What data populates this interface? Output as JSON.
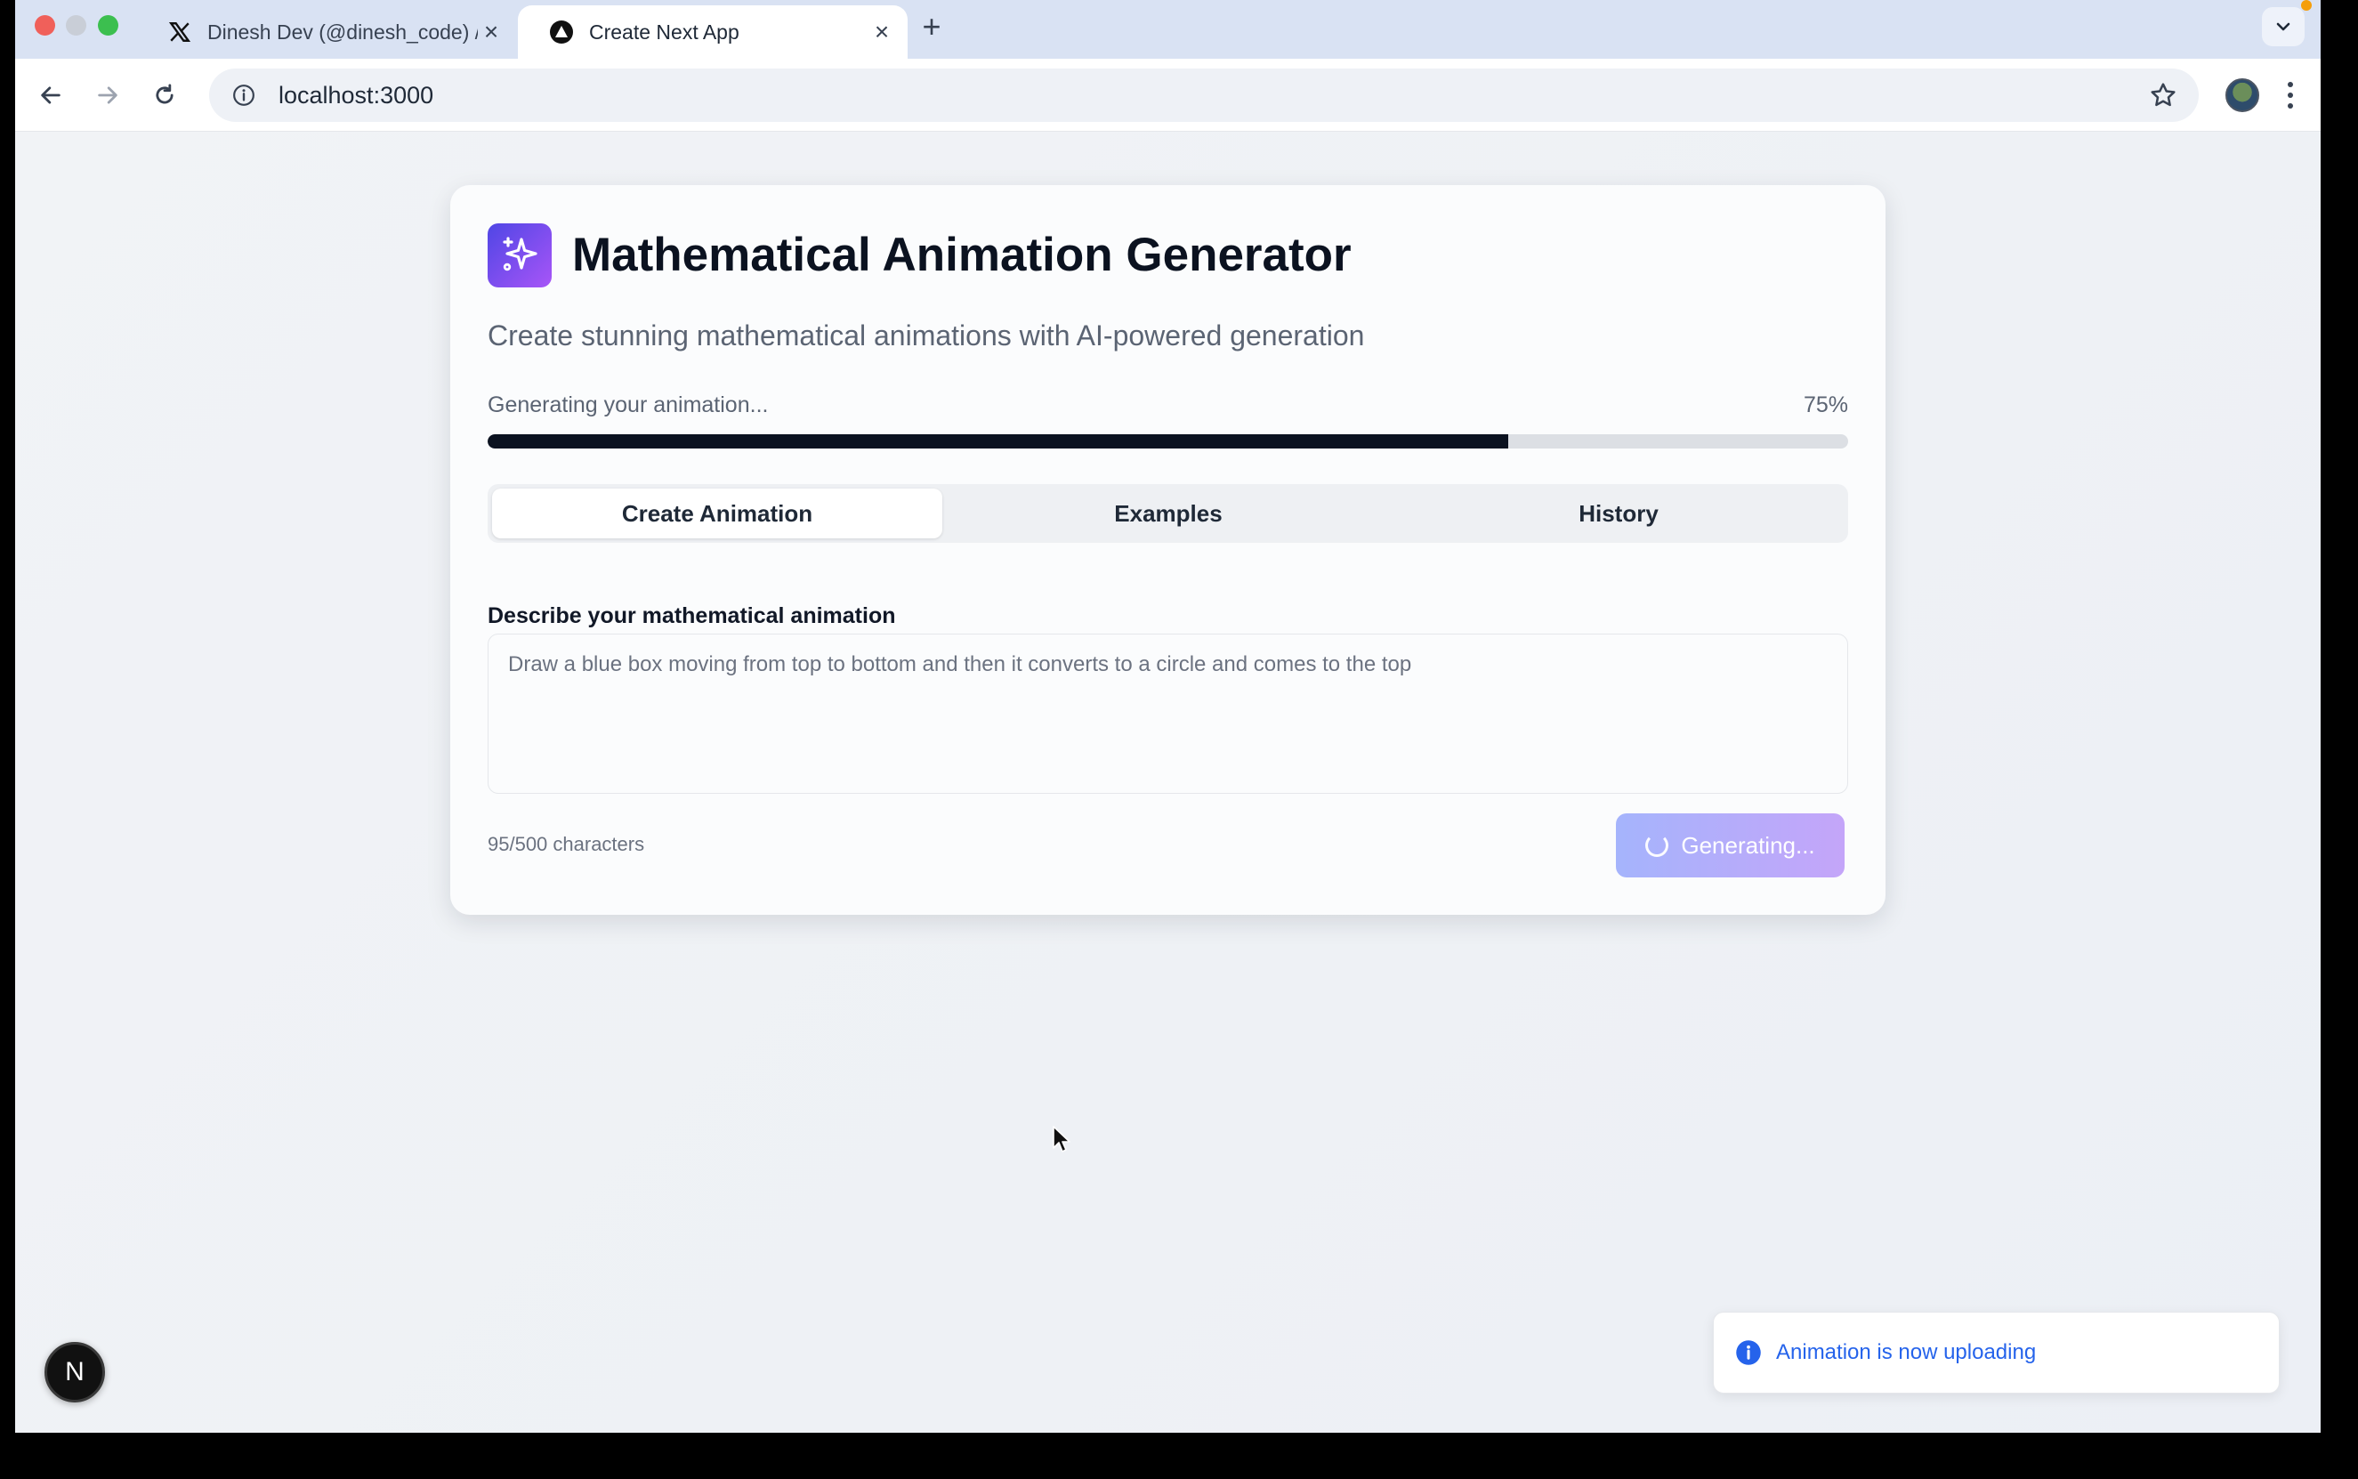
{
  "browser": {
    "tabs": [
      {
        "title": "Dinesh Dev (@dinesh_code) /",
        "favicon": "x-logo-icon",
        "active": false
      },
      {
        "title": "Create Next App",
        "favicon": "vercel-triangle-icon",
        "active": true
      }
    ],
    "new_tab_label": "+",
    "url": "localhost:3000"
  },
  "app": {
    "title": "Mathematical Animation Generator",
    "subtitle": "Create stunning mathematical animations with AI-powered generation",
    "logo_icon": "sparkles-icon",
    "progress": {
      "label": "Generating your animation...",
      "percent_label": "75%",
      "value": 0.75
    },
    "tabs": [
      {
        "label": "Create Animation",
        "active": true
      },
      {
        "label": "Examples",
        "active": false
      },
      {
        "label": "History",
        "active": false
      }
    ],
    "form": {
      "label": "Describe your mathematical animation",
      "prompt_value": "Draw a blue box moving from top to bottom and then it converts to a circle and comes to the top",
      "char_count": "95/500 characters",
      "button_label": "Generating..."
    }
  },
  "toast": {
    "message": "Animation is now uploading",
    "icon": "info-icon"
  },
  "next_badge": {
    "letter": "N"
  },
  "colors": {
    "accent_gradient_start": "#4f46e5",
    "accent_gradient_end": "#a855f7",
    "progress_fill": "#0b1220",
    "toast_text": "#2563eb"
  }
}
